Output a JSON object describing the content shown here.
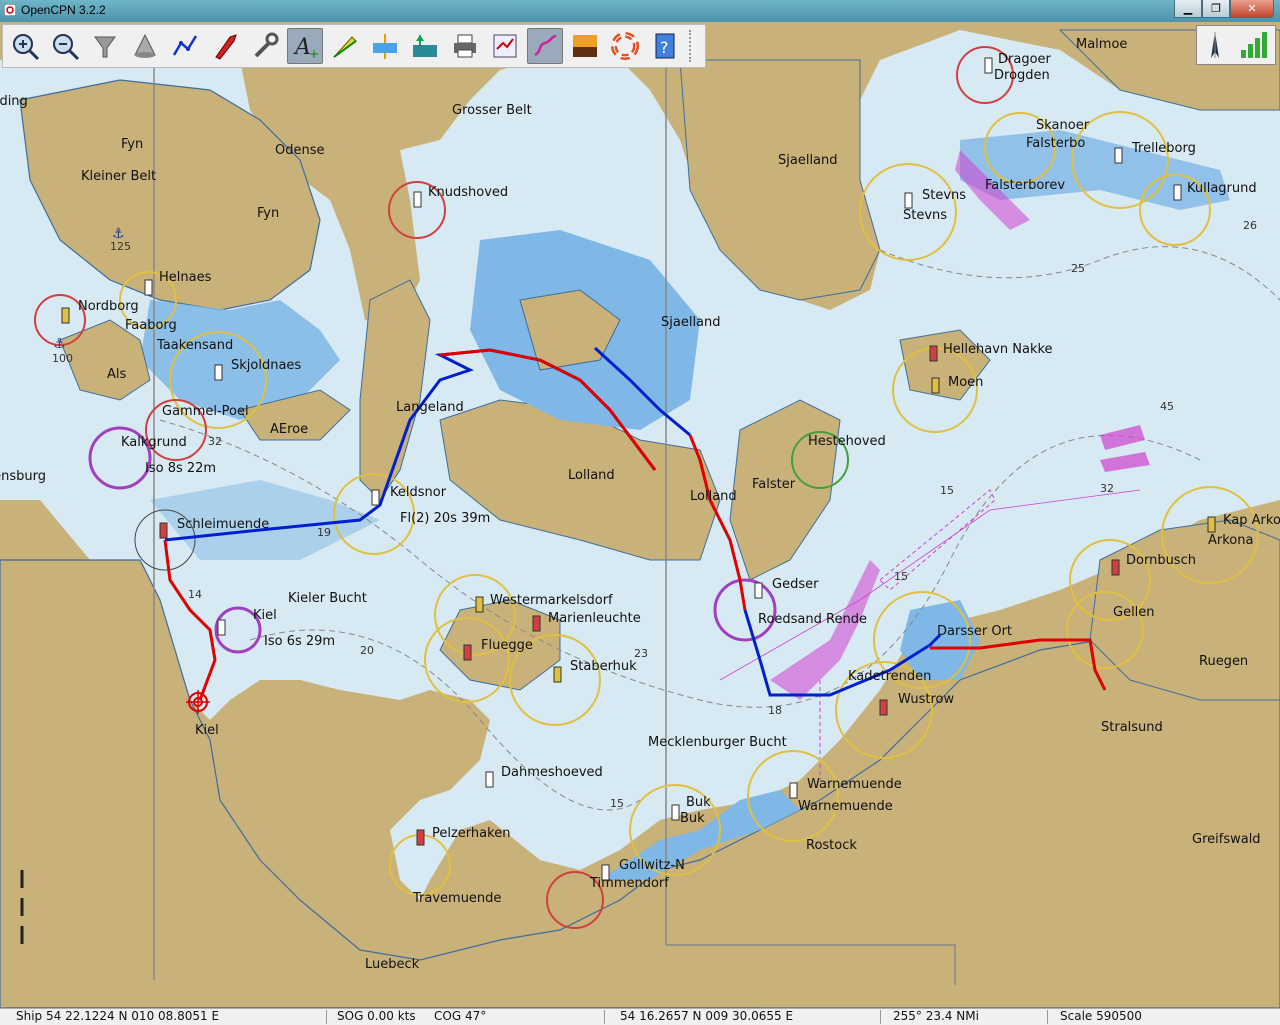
{
  "window": {
    "title": "OpenCPN 3.2.2"
  },
  "toolbar": {
    "buttons": [
      {
        "name": "zoom-in-button",
        "icon": "zoom-in-icon"
      },
      {
        "name": "zoom-out-button",
        "icon": "zoom-out-icon"
      },
      {
        "name": "scale-in-button",
        "icon": "funnel-icon"
      },
      {
        "name": "scale-out-button",
        "icon": "cone-icon"
      },
      {
        "name": "route-button",
        "icon": "route-icon"
      },
      {
        "name": "auto-follow-button",
        "icon": "ship-icon"
      },
      {
        "name": "settings-button",
        "icon": "wrench-icon"
      },
      {
        "name": "text-button",
        "icon": "text-icon"
      },
      {
        "name": "current-button",
        "icon": "current-icon"
      },
      {
        "name": "tide-button",
        "icon": "tide-icon"
      },
      {
        "name": "ais-button",
        "icon": "ais-icon"
      },
      {
        "name": "print-button",
        "icon": "printer-icon"
      },
      {
        "name": "route-manager-button",
        "icon": "route-manager-icon"
      },
      {
        "name": "track-button",
        "icon": "track-icon"
      },
      {
        "name": "colorscheme-button",
        "icon": "sunset-icon"
      },
      {
        "name": "mob-button",
        "icon": "lifebuoy-icon"
      },
      {
        "name": "help-button",
        "icon": "help-icon"
      }
    ]
  },
  "colors": {
    "land": "#c9b17a",
    "deep": "#d7e9f2",
    "shallow": "#7fb7e6",
    "route_red": "#e00000",
    "route_blue": "#0020d0",
    "traffic": "#d040d0"
  },
  "labels": {
    "malmoe": "Malmoe",
    "dragoer": "Dragoer",
    "drogden": "Drogden",
    "kolding": "Kolding",
    "grosser_belt": "Grosser Belt",
    "fyn1": "Fyn",
    "odense": "Odense",
    "kleiner_belt": "Kleiner Belt",
    "fyn2": "Fyn",
    "knudshoved": "Knudshoved",
    "sjaelland1": "Sjaelland",
    "skanoer": "Skanoer",
    "falsterbo": "Falsterbo",
    "trelleborg": "Trelleborg",
    "stevns1": "Stevns",
    "stevns2": "Stevns",
    "falsterborev": "Falsterborev",
    "kullagrund": "Kullagrund",
    "helnaes": "Helnaes",
    "nordborg": "Nordborg",
    "faaborg": "Faaborg",
    "taakensand": "Taakensand",
    "als": "Als",
    "skjoldnaes": "Skjoldnaes",
    "sjaelland2": "Sjaelland",
    "hellehavn": "Hellehavn Nakke",
    "moen": "Moen",
    "langeland": "Langeland",
    "gammel_poel": "Gammel-Poel",
    "aeroe": "AEroe",
    "kalkgrund": "Kalkgrund",
    "iso8": "Iso 8s 22m",
    "hestehoved": "Hestehoved",
    "lolland1": "Lolland",
    "lolland2": "Lolland",
    "falster": "Falster",
    "flensburg": "Flensburg",
    "keldsnor": "Keldsnor",
    "fl2": "Fl(2) 20s 39m",
    "schleimuende": "Schleimuende",
    "kap_arkona": "Kap Arkona",
    "arkona": "Arkona",
    "dornbusch": "Dornbusch",
    "gedser": "Gedser",
    "kieler_bucht": "Kieler Bucht",
    "westermarkelsdorf": "Westermarkelsdorf",
    "marienleuchte": "Marienleuchte",
    "gellen": "Gellen",
    "kiel": "Kiel",
    "iso6": "Iso 6s 29m",
    "fluegge": "Fluegge",
    "roedsand": "Roedsand Rende",
    "darsser": "Darsser Ort",
    "ruegen": "Ruegen",
    "staberhuk": "Staberhuk",
    "kadetrenden": "Kadetrenden",
    "wustrow": "Wustrow",
    "stralsund": "Stralsund",
    "kiel_city": "Kiel",
    "mecklenburger": "Mecklenburger Bucht",
    "dahmeshoeved": "Dahmeshoeved",
    "warnemuende1": "Warnemuende",
    "warnemuende2": "Warnemuende",
    "buk1": "Buk",
    "buk2": "Buk",
    "pelzerhaken": "Pelzerhaken",
    "rostock": "Rostock",
    "greifswald": "Greifswald",
    "gollwitz": "Gollwitz-N",
    "timmendorf": "Timmendorf",
    "travemuende": "Travemuende",
    "luebeck": "Luebeck"
  },
  "depths": {
    "d26": "26",
    "d25": "25",
    "d125": "125",
    "d100": "100",
    "d45": "45",
    "d32a": "32",
    "d32b": "32",
    "d15a": "15",
    "d19": "19",
    "d15b": "15",
    "d14": "14",
    "d20": "20",
    "d23": "23",
    "d18": "18",
    "d15c": "15"
  },
  "loading": {
    "progress": 1.0
  },
  "status": {
    "ship": "Ship 54 22.1224 N   010 08.8051 E",
    "sog": "SOG 0.00 kts",
    "cog": "COG 47°",
    "cursor": "54 16.2657 N    009 30.0655 E",
    "bearing": "255°  23.4 NMi",
    "scale": "Scale 590500"
  }
}
